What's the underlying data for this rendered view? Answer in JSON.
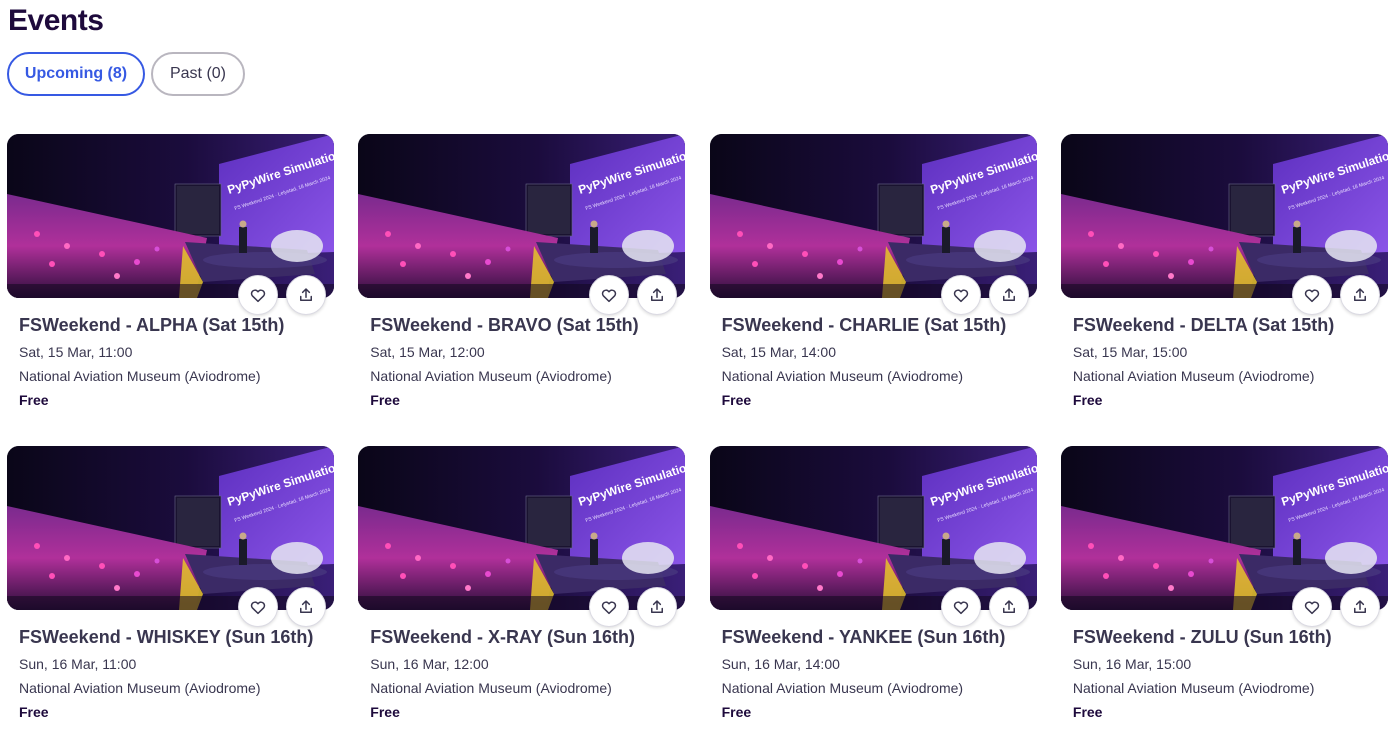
{
  "page": {
    "title": "Events"
  },
  "tabs": [
    {
      "label": "Upcoming (8)",
      "active": true
    },
    {
      "label": "Past (0)",
      "active": false
    }
  ],
  "image": {
    "banner_line1": "PyPyWire Simulations",
    "banner_line2": "FS Weekend 2024 · Lelystad, 18 March 2024"
  },
  "colors": {
    "accent": "#3659e3",
    "heading": "#1e0a3c",
    "text": "#39364f",
    "border": "#b9b6bf"
  },
  "events": [
    {
      "title": "FSWeekend - ALPHA (Sat 15th)",
      "date": "Sat, 15 Mar, 11:00",
      "venue": "National Aviation Museum (Aviodrome)",
      "price": "Free"
    },
    {
      "title": "FSWeekend - BRAVO (Sat 15th)",
      "date": "Sat, 15 Mar, 12:00",
      "venue": "National Aviation Museum (Aviodrome)",
      "price": "Free"
    },
    {
      "title": "FSWeekend - CHARLIE (Sat 15th)",
      "date": "Sat, 15 Mar, 14:00",
      "venue": "National Aviation Museum (Aviodrome)",
      "price": "Free"
    },
    {
      "title": "FSWeekend - DELTA (Sat 15th)",
      "date": "Sat, 15 Mar, 15:00",
      "venue": "National Aviation Museum (Aviodrome)",
      "price": "Free"
    },
    {
      "title": "FSWeekend - WHISKEY (Sun 16th)",
      "date": "Sun, 16 Mar, 11:00",
      "venue": "National Aviation Museum (Aviodrome)",
      "price": "Free"
    },
    {
      "title": "FSWeekend - X-RAY (Sun 16th)",
      "date": "Sun, 16 Mar, 12:00",
      "venue": "National Aviation Museum (Aviodrome)",
      "price": "Free"
    },
    {
      "title": "FSWeekend - YANKEE (Sun 16th)",
      "date": "Sun, 16 Mar, 14:00",
      "venue": "National Aviation Museum (Aviodrome)",
      "price": "Free"
    },
    {
      "title": "FSWeekend - ZULU (Sun 16th)",
      "date": "Sun, 16 Mar, 15:00",
      "venue": "National Aviation Museum (Aviodrome)",
      "price": "Free"
    }
  ],
  "icons": {
    "like": "heart-icon",
    "share": "share-icon"
  }
}
